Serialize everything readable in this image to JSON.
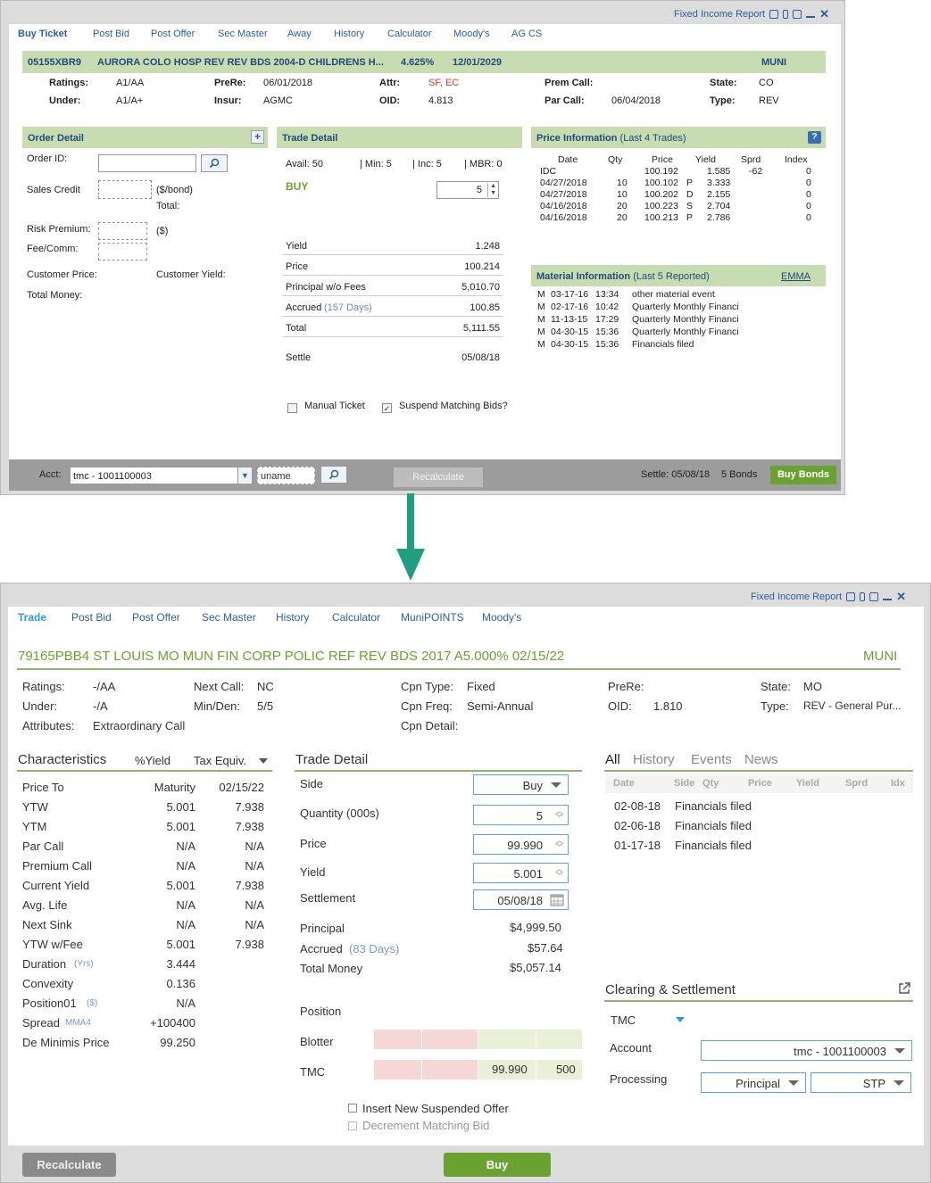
{
  "top": {
    "toolbar": {
      "report_link": "Fixed Income Report"
    },
    "tabs": [
      "Buy Ticket",
      "Post Bid",
      "Post Offer",
      "Sec Master",
      "Away",
      "History",
      "Calculator",
      "Moody's",
      "AG CS"
    ],
    "security": {
      "cusip": "05155XBR9",
      "name": "AURORA COLO HOSP REV REV BDS 2004-D CHILDRENS H...",
      "coupon": "4.625%",
      "maturity": "12/01/2029",
      "type": "MUNI"
    },
    "info": {
      "ratings_label": "Ratings:",
      "ratings": "A1/AA",
      "under_label": "Under:",
      "under": "A1/A+",
      "prere_label": "PreRe:",
      "prere": "06/01/2018",
      "insur_label": "Insur:",
      "insur": "AGMC",
      "attr_label": "Attr:",
      "attr": "SF, EC",
      "oid_label": "OID:",
      "oid": "4.813",
      "premcall_label": "Prem Call:",
      "premcall": "",
      "parcall_label": "Par Call:",
      "parcall": "06/04/2018",
      "state_label": "State:",
      "state": "CO",
      "type_label": "Type:",
      "type": "REV"
    },
    "order_detail": {
      "title": "Order Detail",
      "plus": "+",
      "order_id": "Order ID:",
      "sales_credit": "Sales Credit",
      "per_bond": "($/bond)",
      "total": "Total:",
      "risk_premium": "Risk Premium:",
      "dollar": "($)",
      "fee_comm": "Fee/Comm:",
      "customer_price": "Customer Price:",
      "customer_yield": "Customer Yield:",
      "total_money": "Total Money:"
    },
    "trade_detail": {
      "title": "Trade Detail",
      "avail": "Avail: 50",
      "min": "| Min: 5",
      "inc": "| Inc: 5",
      "mbr": "| MBR: 0",
      "side": "BUY",
      "qty": "5",
      "rows": [
        {
          "label": "Yield",
          "value": "1.248"
        },
        {
          "label": "Price",
          "value": "100.214"
        },
        {
          "label": "Principal w/o Fees",
          "value": "5,010.70"
        },
        {
          "label": "Accrued",
          "sub": "(157 Days)",
          "value": "100.85"
        },
        {
          "label": "Total",
          "value": "5,111.55"
        },
        {
          "label": "Settle",
          "value": "05/08/18"
        }
      ],
      "manual_ticket": "Manual Ticket",
      "suspend_matching": "Suspend Matching Bids?"
    },
    "price_info": {
      "title": "Price Information",
      "sub": "(Last 4 Trades)",
      "help": "?",
      "headers": [
        "Date",
        "Qty",
        "Price",
        "Yield",
        "Sprd",
        "Index"
      ],
      "rows": [
        [
          "IDC",
          "",
          "100.192",
          "",
          "1.585",
          "-62",
          "0"
        ],
        [
          "04/27/2018",
          "10",
          "100.102",
          "P",
          "3.333",
          "",
          "0"
        ],
        [
          "04/27/2018",
          "10",
          "100.202",
          "D",
          "2.155",
          "",
          "0"
        ],
        [
          "04/16/2018",
          "20",
          "100.223",
          "S",
          "2.704",
          "",
          "0"
        ],
        [
          "04/16/2018",
          "20",
          "100.213",
          "P",
          "2.786",
          "",
          "0"
        ]
      ]
    },
    "material_info": {
      "title": "Material Information",
      "sub": "(Last 5 Reported)",
      "emma": "EMMA",
      "rows": [
        [
          "M",
          "03-17-16",
          "13:34",
          "other material event"
        ],
        [
          "M",
          "02-17-16",
          "10:42",
          "Quarterly Monthly Financi"
        ],
        [
          "M",
          "11-13-15",
          "17:29",
          "Quarterly Monthly Financi"
        ],
        [
          "M",
          "04-30-15",
          "15:36",
          "Quarterly Monthly Financi"
        ],
        [
          "M",
          "04-30-15",
          "15:36",
          "Financials filed"
        ]
      ]
    },
    "bottom_bar": {
      "acct_label": "Acct:",
      "acct_value": "tmc - 1001100003",
      "uname_placeholder": "uname",
      "recalculate": "Recalculate",
      "settle": "Settle: 05/08/18",
      "bonds": "5 Bonds",
      "buy_bonds": "Buy Bonds"
    }
  },
  "bottom": {
    "toolbar": {
      "report_link": "Fixed Income Report"
    },
    "tabs": [
      "Trade",
      "Post Bid",
      "Post Offer",
      "Sec Master",
      "History",
      "Calculator",
      "MuniPOINTS",
      "Moody's"
    ],
    "title": "79165PBB4  ST LOUIS MO MUN FIN CORP POLIC REF REV BDS 2017 A5.000% 02/15/22",
    "title_type": "MUNI",
    "info": {
      "ratings_label": "Ratings:",
      "ratings": "-/AA",
      "under_label": "Under:",
      "under": "-/A",
      "attributes_label": "Attributes:",
      "attributes": "Extraordinary Call",
      "nextcall_label": "Next Call:",
      "nextcall": "NC",
      "minden_label": "Min/Den:",
      "minden": "5/5",
      "cpntype_label": "Cpn Type:",
      "cpntype": "Fixed",
      "cpnfreq_label": "Cpn Freq:",
      "cpnfreq": "Semi-Annual",
      "cpndetail_label": "Cpn Detail:",
      "prere_label": "PreRe:",
      "oid_label": "OID:",
      "oid": "1.810",
      "state_label": "State:",
      "state": "MO",
      "type_label": "Type:",
      "type": "REV - General Pur..."
    },
    "characteristics": {
      "title": "Characteristics",
      "col1": "%Yield",
      "col2": "Tax Equiv.",
      "rows": [
        {
          "label": "Price To",
          "sub": "",
          "v1": "Maturity",
          "v2": "02/15/22"
        },
        {
          "label": "YTW",
          "sub": "",
          "v1": "5.001",
          "v2": "7.938"
        },
        {
          "label": "YTM",
          "sub": "",
          "v1": "5.001",
          "v2": "7.938"
        },
        {
          "label": "Par Call",
          "sub": "",
          "v1": "N/A",
          "v2": "N/A"
        },
        {
          "label": "Premium Call",
          "sub": "",
          "v1": "N/A",
          "v2": "N/A"
        },
        {
          "label": "Current Yield",
          "sub": "",
          "v1": "5.001",
          "v2": "7.938"
        },
        {
          "label": "Avg. Life",
          "sub": "",
          "v1": "N/A",
          "v2": "N/A"
        },
        {
          "label": "Next Sink",
          "sub": "",
          "v1": "N/A",
          "v2": "N/A"
        },
        {
          "label": "YTW w/Fee",
          "sub": "",
          "v1": "5.001",
          "v2": "7.938"
        },
        {
          "label": "Duration",
          "sub": "(Yrs)",
          "v1": "3.444",
          "v2": ""
        },
        {
          "label": "Convexity",
          "sub": "",
          "v1": "0.136",
          "v2": ""
        },
        {
          "label": "Position01",
          "sub": "($)",
          "v1": "N/A",
          "v2": ""
        },
        {
          "label": "Spread",
          "sub": "MMA4",
          "v1": "+100400",
          "v2": ""
        },
        {
          "label": "De Minimis Price",
          "sub": "",
          "v1": "99.250",
          "v2": ""
        }
      ]
    },
    "trade_detail": {
      "title": "Trade Detail",
      "side_label": "Side",
      "side": "Buy",
      "qty_label": "Quantity (000s)",
      "qty": "5",
      "price_label": "Price",
      "price": "99.990",
      "yield_label": "Yield",
      "yield": "5.001",
      "settle_label": "Settlement",
      "settle": "05/08/18",
      "principal_label": "Principal",
      "principal": "$4,999.50",
      "accrued_label": "Accrued",
      "accrued_sub": "(83 Days)",
      "accrued": "$57.64",
      "total_label": "Total Money",
      "total": "$5,057.14",
      "position_label": "Position",
      "blotter_label": "Blotter",
      "tmc_label": "TMC",
      "tmc_price": "99.990",
      "tmc_qty": "500",
      "insert_offer": "Insert New Suspended Offer",
      "decrement_bid": "Decrement Matching Bid"
    },
    "history": {
      "tabs": [
        "All",
        "History",
        "Events",
        "News"
      ],
      "headers": [
        "Date",
        "Side",
        "Qty",
        "Price",
        "Yield",
        "Sprd",
        "Idx"
      ],
      "rows": [
        [
          "02-08-18",
          "Financials filed"
        ],
        [
          "02-06-18",
          "Financials filed"
        ],
        [
          "01-17-18",
          "Financials filed"
        ]
      ]
    },
    "clearing": {
      "title": "Clearing & Settlement",
      "tmc": "TMC",
      "account_label": "Account",
      "account": "tmc - 1001100003",
      "processing_label": "Processing",
      "processing1": "Principal",
      "processing2": "STP"
    },
    "footer": {
      "recalculate": "Recalculate",
      "buy": "Buy"
    }
  },
  "colors": {
    "accent_green": "#6aa232",
    "link_blue": "#2c5fa0",
    "header_green": "#c7dcb0",
    "arrow": "#1f9e80",
    "alert_red": "#e03030"
  }
}
